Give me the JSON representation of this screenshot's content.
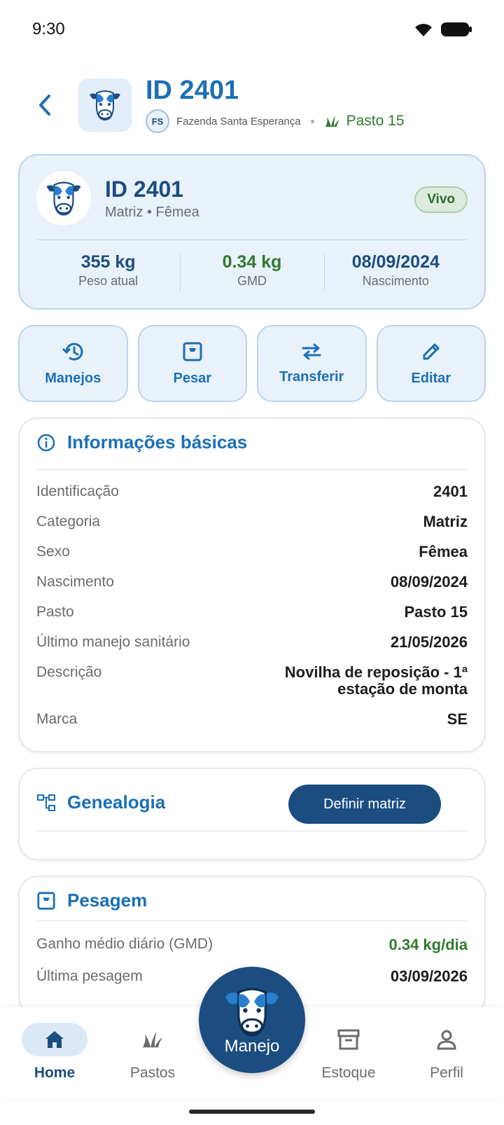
{
  "status_bar": {
    "time": "9:30"
  },
  "header": {
    "title": "ID 2401",
    "farm_badge": "FS",
    "farm_name": "Fazenda Santa Esperança",
    "pasture": "Pasto 15"
  },
  "summary": {
    "title": "ID 2401",
    "subtitle": "Matriz • Fêmea",
    "status": "Vivo",
    "stats": [
      {
        "value": "355 kg",
        "label": "Peso atual"
      },
      {
        "value": "0.34 kg",
        "label": "GMD"
      },
      {
        "value": "08/09/2024",
        "label": "Nascimento"
      }
    ]
  },
  "actions": [
    {
      "label": "Manejos",
      "icon": "history-icon"
    },
    {
      "label": "Pesar",
      "icon": "scale-icon"
    },
    {
      "label": "Transferir",
      "icon": "transfer-icon"
    },
    {
      "label": "Editar",
      "icon": "pencil-icon"
    }
  ],
  "info": {
    "title": "Informações básicas",
    "rows": [
      {
        "label": "Identificação",
        "value": "2401"
      },
      {
        "label": "Categoria",
        "value": "Matriz"
      },
      {
        "label": "Sexo",
        "value": "Fêmea"
      },
      {
        "label": "Nascimento",
        "value": "08/09/2024"
      },
      {
        "label": "Pasto",
        "value": "Pasto 15"
      },
      {
        "label": "Último manejo sanitário",
        "value": "21/05/2026"
      },
      {
        "label": "Descrição",
        "value": "Novilha de reposição - 1ª estação de monta"
      },
      {
        "label": "Marca",
        "value": "SE"
      }
    ]
  },
  "genealogy": {
    "title": "Genealogia",
    "button": "Definir matriz"
  },
  "weighing": {
    "title": "Pesagem",
    "rows": [
      {
        "label": "Ganho médio diário (GMD)",
        "value": "0.34 kg/dia"
      },
      {
        "label": "Última pesagem",
        "value": "03/09/2026"
      }
    ]
  },
  "nav": {
    "items": [
      {
        "label": "Home",
        "icon": "home-icon"
      },
      {
        "label": "Pastos",
        "icon": "grass-icon"
      },
      {
        "label": "Manejo",
        "icon": "cow-icon"
      },
      {
        "label": "Estoque",
        "icon": "archive-icon"
      },
      {
        "label": "Perfil",
        "icon": "person-icon"
      }
    ]
  },
  "colors": {
    "primary": "#1c6fb5",
    "primary_dark": "#1b4d80",
    "card_bg": "#e9f2fb",
    "success": "#2f7a2f"
  }
}
